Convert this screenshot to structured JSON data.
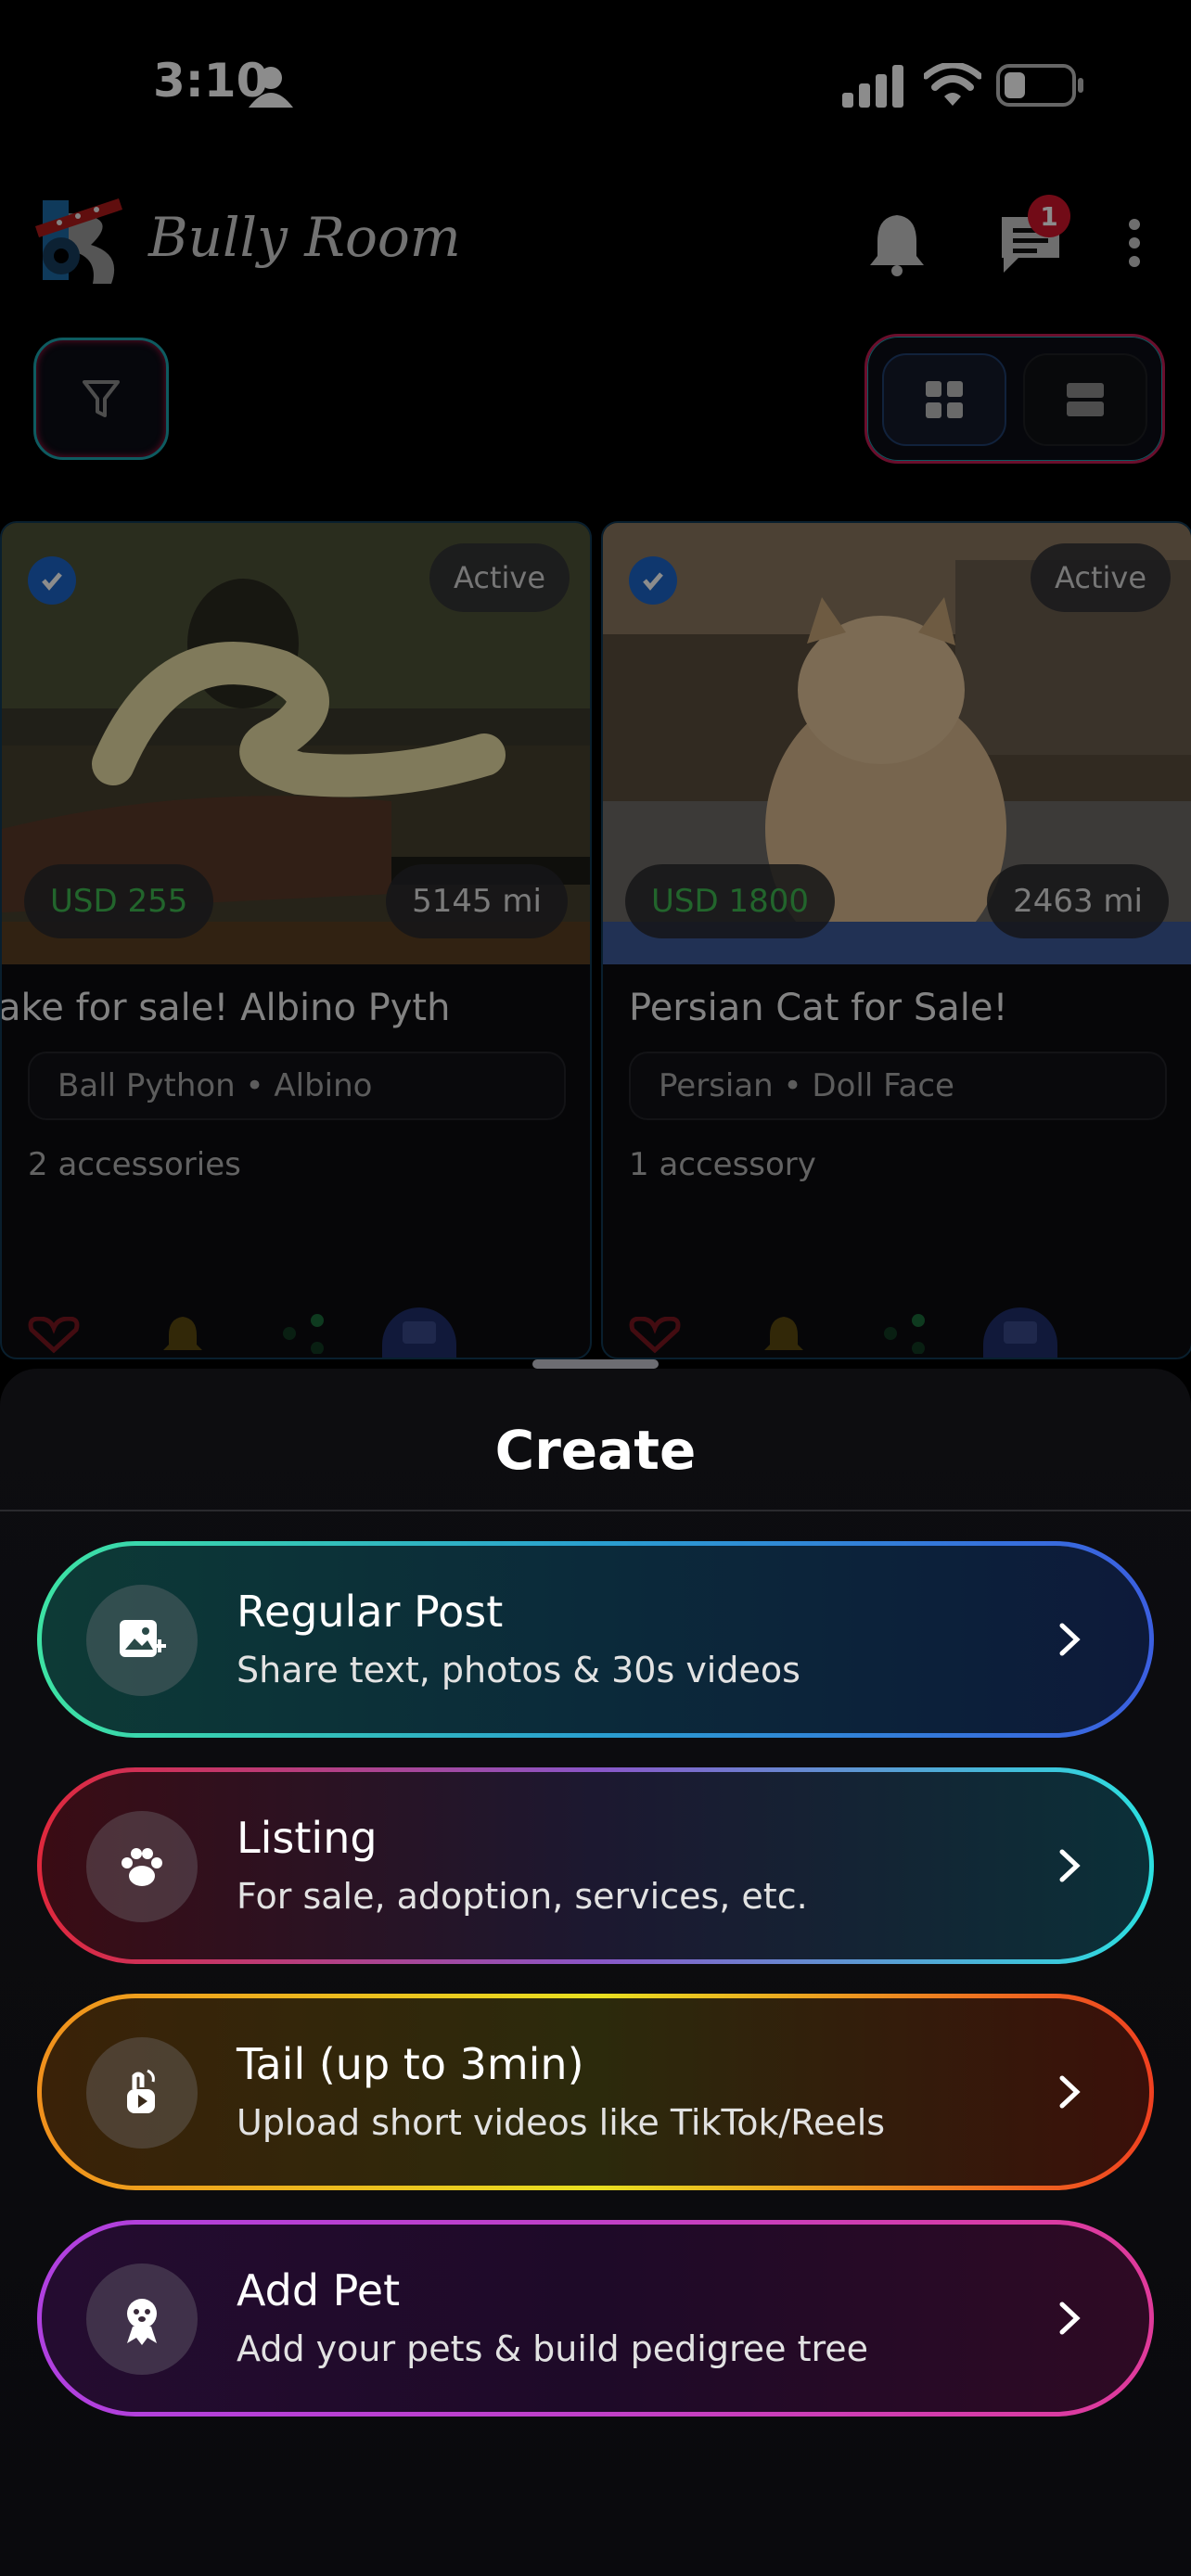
{
  "status_bar": {
    "time": "3:10"
  },
  "header": {
    "brand": "Bully Room",
    "chat_badge": "1"
  },
  "cards": [
    {
      "status": "Active",
      "price": "USD 255",
      "distance": "5145 mi",
      "title": "ake for sale!      Albino Pyth",
      "tags": "Ball Python • Albino",
      "accessories": "2 accessories"
    },
    {
      "status": "Active",
      "price": "USD 1800",
      "distance": "2463 mi",
      "title": "Persian Cat for Sale!",
      "tags": "Persian • Doll Face",
      "accessories": "1 accessory"
    }
  ],
  "sheet": {
    "title": "Create",
    "options": [
      {
        "title": "Regular Post",
        "subtitle": "Share text, photos & 30s videos",
        "icon": "image-add-icon"
      },
      {
        "title": "Listing",
        "subtitle": "For sale, adoption, services, etc.",
        "icon": "paw-icon"
      },
      {
        "title": "Tail (up to 3min)",
        "subtitle": "Upload short videos like TikTok/Reels",
        "icon": "video-hand-icon"
      },
      {
        "title": "Add Pet",
        "subtitle": "Add your pets & build pedigree tree",
        "icon": "pet-badge-icon"
      }
    ]
  },
  "colors": {
    "price_green": "#3fb950",
    "verified_blue": "#1d64c8",
    "badge_red": "#d0152a"
  }
}
